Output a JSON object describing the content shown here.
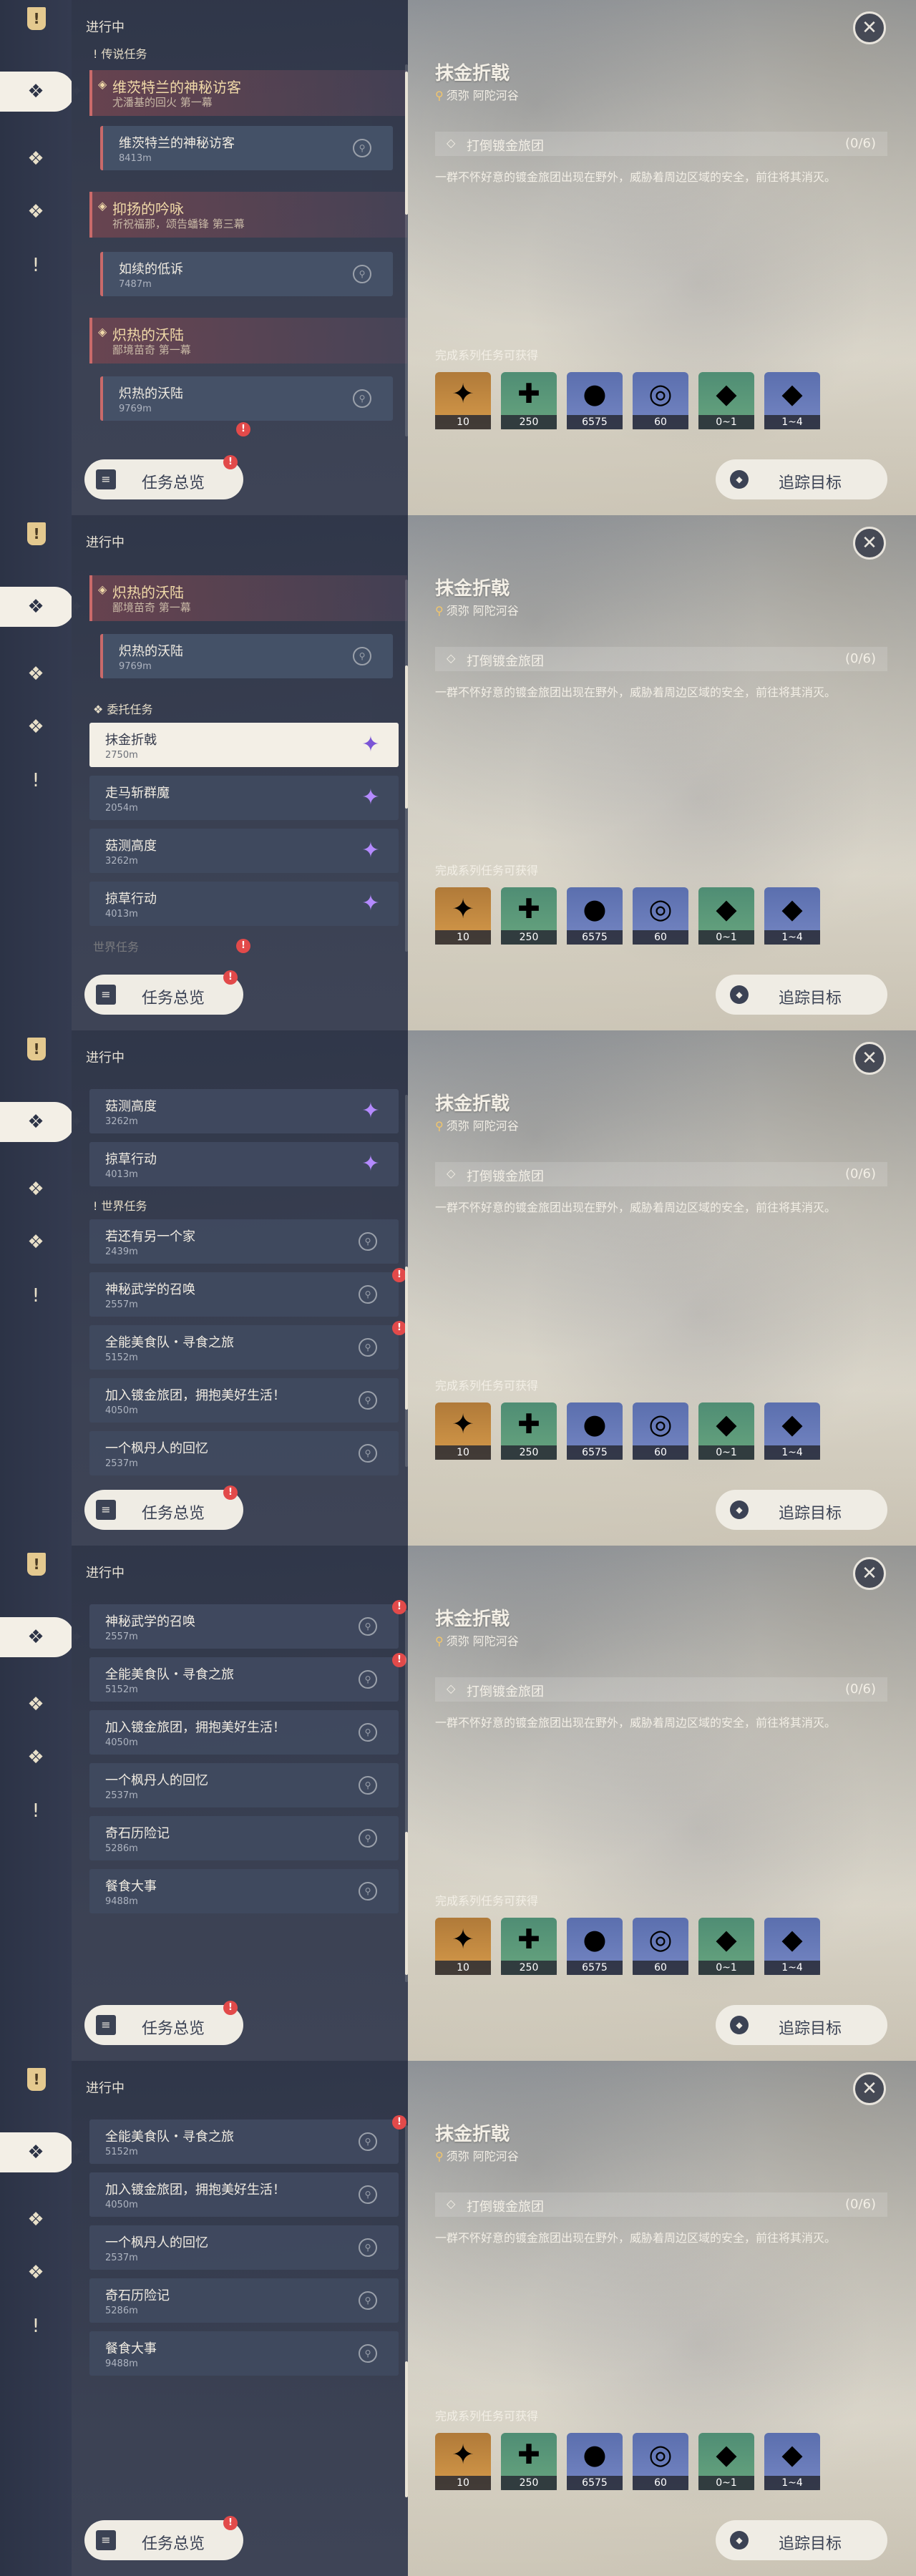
{
  "common": {
    "section_title": "进行中",
    "overview_label": "任务总览",
    "track_label": "追踪目标",
    "close_glyph": "✕",
    "sidebar_icons": [
      "!",
      "❖",
      "❖",
      "❖",
      "!"
    ]
  },
  "detail": {
    "title": "抹金折戟",
    "location": "须弥 阿陀河谷",
    "objective": "打倒镀金旅团",
    "objective_count": "(0/6)",
    "description": "一群不怀好意的镀金旅团出现在野外，威胁着周边区域的安全，前往将其消灭。",
    "reward_title": "完成系列任务可获得",
    "rewards": [
      {
        "icon": "primogem-icon",
        "glyph": "✦",
        "count": "10",
        "color": "orange"
      },
      {
        "icon": "adventure-exp-icon",
        "glyph": "✚",
        "count": "250",
        "color": "green"
      },
      {
        "icon": "mora-icon",
        "glyph": "●",
        "count": "6575",
        "color": "blue"
      },
      {
        "icon": "companionship-icon",
        "glyph": "◎",
        "count": "60",
        "color": "blue"
      },
      {
        "icon": "ore-icon",
        "glyph": "◆",
        "count": "0~1",
        "color": "green"
      },
      {
        "icon": "crystal-icon",
        "glyph": "◆",
        "count": "1~4",
        "color": "blue"
      }
    ]
  },
  "frames": [
    {
      "group_legend": "传说任务",
      "legend1": {
        "title": "维茨特兰的神秘访客",
        "subtitle": "尤潘基的回火 第一幕"
      },
      "legend1_sub": {
        "name": "维茨特兰的神秘访客",
        "dist": "8413m"
      },
      "legend2": {
        "title": "抑扬的吟咏",
        "subtitle": "祈祝福那，颂告蟠锋 第三幕"
      },
      "legend2_sub": {
        "name": "如续的低诉",
        "dist": "7487m"
      },
      "legend3": {
        "title": "炽热的沃陆",
        "subtitle": "鄙境苗奇 第一幕"
      },
      "legend3_sub": {
        "name": "炽热的沃陆",
        "dist": "9769m"
      }
    },
    {
      "legend3": {
        "title": "炽热的沃陆",
        "subtitle": "鄙境苗奇 第一幕"
      },
      "legend3_sub": {
        "name": "炽热的沃陆",
        "dist": "9769m"
      },
      "group_commission": "委托任务",
      "commissions": [
        {
          "name": "抹金折戟",
          "dist": "2750m"
        },
        {
          "name": "走马斩群魔",
          "dist": "2054m"
        },
        {
          "name": "菇测高度",
          "dist": "3262m"
        },
        {
          "name": "掠草行动",
          "dist": "4013m"
        }
      ],
      "group_world": "世界任务"
    },
    {
      "commissions": [
        {
          "name": "菇测高度",
          "dist": "3262m"
        },
        {
          "name": "掠草行动",
          "dist": "4013m"
        }
      ],
      "group_world": "世界任务",
      "world": [
        {
          "name": "若还有另一个家",
          "dist": "2439m"
        },
        {
          "name": "神秘武学的召唤",
          "dist": "2557m"
        },
        {
          "name": "全能美食队・寻食之旅",
          "dist": "5152m"
        },
        {
          "name": "加入镀金旅团，拥抱美好生活！",
          "dist": "4050m"
        },
        {
          "name": "一个枫丹人的回忆",
          "dist": "2537m"
        }
      ]
    },
    {
      "world": [
        {
          "name": "神秘武学的召唤",
          "dist": "2557m"
        },
        {
          "name": "全能美食队・寻食之旅",
          "dist": "5152m"
        },
        {
          "name": "加入镀金旅团，拥抱美好生活！",
          "dist": "4050m"
        },
        {
          "name": "一个枫丹人的回忆",
          "dist": "2537m"
        },
        {
          "name": "奇石历险记",
          "dist": "5286m"
        },
        {
          "name": "餐食大事",
          "dist": "9488m"
        }
      ]
    },
    {
      "world": [
        {
          "name": "全能美食队・寻食之旅",
          "dist": "5152m"
        },
        {
          "name": "加入镀金旅团，拥抱美好生活！",
          "dist": "4050m"
        },
        {
          "name": "一个枫丹人的回忆",
          "dist": "2537m"
        },
        {
          "name": "奇石历险记",
          "dist": "5286m"
        },
        {
          "name": "餐食大事",
          "dist": "9488m"
        }
      ]
    }
  ]
}
